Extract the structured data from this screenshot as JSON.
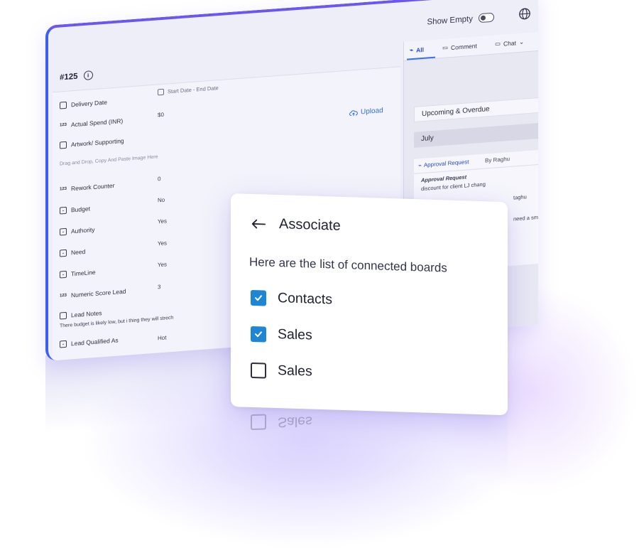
{
  "window": {
    "ticket_id": "#125",
    "show_empty_label": "Show Empty",
    "show_empty_on": false
  },
  "fields": {
    "delivery_date": {
      "label": "Delivery Date",
      "value": "Start Date - End Date"
    },
    "actual_spend": {
      "label": "Actual Spend (INR)",
      "value": "$0"
    },
    "artwork": {
      "label": "Artwork/ Supporting",
      "hint": "Drag and Drop, Copy And Paste Image Here",
      "upload_label": "Upload"
    },
    "rework_counter": {
      "label": "Rework Counter",
      "value": "0"
    },
    "budget": {
      "label": "Budget",
      "value": "No"
    },
    "authority": {
      "label": "Authority",
      "value": "Yes"
    },
    "need": {
      "label": "Need",
      "value": "Yes"
    },
    "timeline": {
      "label": "TimeLine",
      "value": "Yes"
    },
    "numeric_score": {
      "label": "Numeric Score Lead",
      "value": "3"
    },
    "lead_notes": {
      "label": "Lead Notes",
      "value": "There budget is likely low, but i thing they will strech"
    },
    "lead_qualified": {
      "label": "Lead Qualified As",
      "value": "Hot"
    }
  },
  "activity": {
    "tabs": [
      {
        "label": "All",
        "active": true
      },
      {
        "label": "Comment",
        "active": false
      },
      {
        "label": "Chat",
        "active": false
      }
    ],
    "upcoming_label": "Upcoming & Overdue",
    "month_label": "July",
    "card": {
      "type_label": "Approval Request",
      "by_label": "By Raghu",
      "title": "Approval Request",
      "line1": "discount for client LJ chang",
      "line2": "taghu",
      "line3": "need a sm"
    }
  },
  "dialog": {
    "title": "Associate",
    "subtitle": "Here are the list of connected boards",
    "options": [
      {
        "label": "Contacts",
        "checked": true
      },
      {
        "label": "Sales",
        "checked": true
      },
      {
        "label": "Sales",
        "checked": false
      }
    ]
  },
  "colors": {
    "accent_blue": "#1f86d6",
    "link_blue": "#2f6fe0",
    "border_gradient_start": "#3d5ff0",
    "border_gradient_end": "#8b52e8"
  },
  "icons": {
    "calendar": "calendar-icon",
    "number": "number-icon",
    "image": "image-icon",
    "dropdown": "dropdown-icon",
    "notes": "notes-icon",
    "upload": "cloud-upload-icon",
    "back": "arrow-left-icon",
    "globe": "globe-icon",
    "info": "info-icon"
  }
}
